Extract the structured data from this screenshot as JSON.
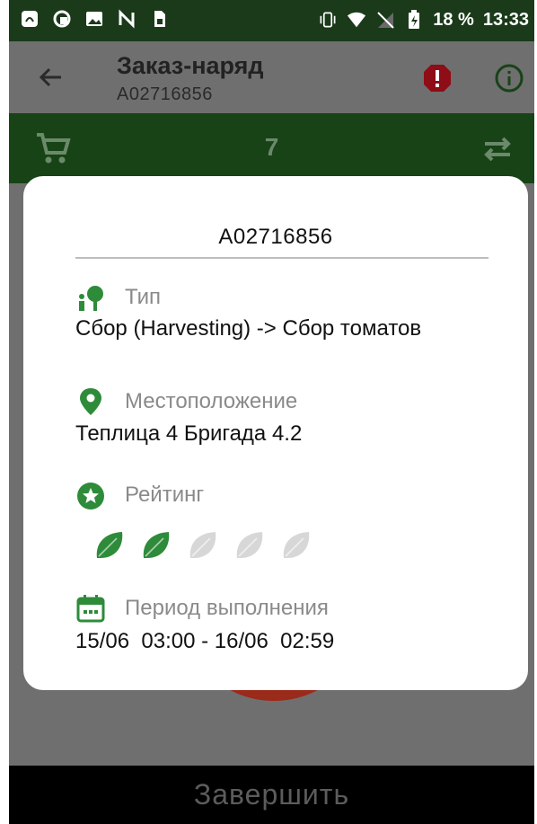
{
  "status_bar": {
    "battery": "18 %",
    "time": "13:33"
  },
  "header": {
    "title": "Заказ-наряд",
    "subtitle": "A02716856"
  },
  "green_bar": {
    "count": "7"
  },
  "bottom": {
    "finish_label": "Завершить"
  },
  "dialog": {
    "title": "A02716856",
    "type": {
      "label": "Тип",
      "value": "Сбор (Harvesting) -> Сбор томатов"
    },
    "location": {
      "label": "Местоположение",
      "value": "Теплица 4 Бригада 4.2"
    },
    "rating": {
      "label": "Рейтинг",
      "value": 2,
      "max": 5
    },
    "period": {
      "label": "Период выполнения",
      "value": "15/06  03:00 - 16/06  02:59"
    }
  },
  "colors": {
    "accent_green": "#2e8b3a",
    "dark_green": "#174317",
    "alert_red": "#c4121f",
    "leaf_inactive": "#d7d7d7"
  },
  "icons": {
    "back": "arrow-left-icon",
    "alert": "alert-icon",
    "info": "info-icon",
    "cart": "cart-icon",
    "swap": "swap-icon",
    "type": "tree-person-icon",
    "location": "location-pin-icon",
    "rating": "star-circle-icon",
    "period": "calendar-icon",
    "leaf": "leaf-icon"
  }
}
